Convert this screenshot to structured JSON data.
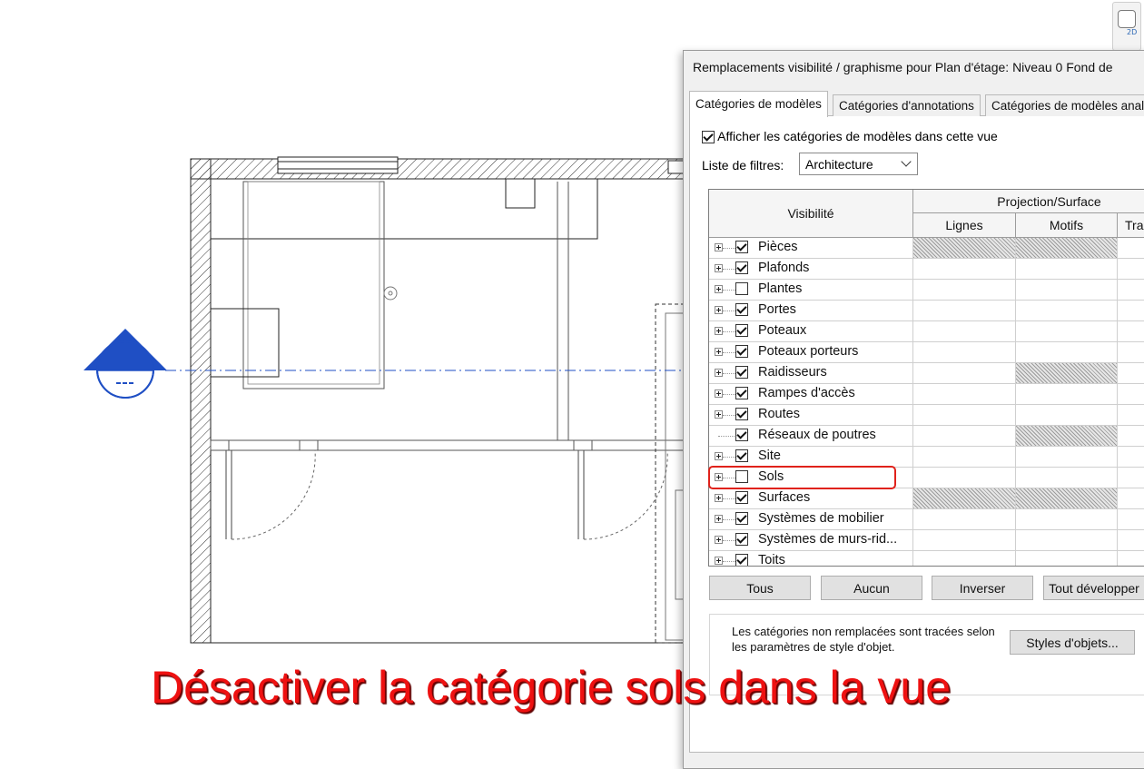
{
  "dialog": {
    "title": "Remplacements visibilité / graphisme pour Plan d'étage: Niveau 0 Fond de",
    "tabs": [
      {
        "label": "Catégories de modèles",
        "active": true
      },
      {
        "label": "Catégories d'annotations",
        "active": false
      },
      {
        "label": "Catégories de modèles anal",
        "active": false
      }
    ],
    "show_categories_label": "Afficher les catégories de modèles dans cette vue",
    "show_categories_checked": true,
    "filter_list_label": "Liste de filtres:",
    "filter_value": "Architecture"
  },
  "grid": {
    "header_visibility": "Visibilité",
    "header_group": "Projection/Surface",
    "columns": [
      "Lignes",
      "Motifs",
      "Tra"
    ],
    "rows": [
      {
        "name": "Pièces",
        "checked": true,
        "expandable": true,
        "hatch": [
          true,
          true
        ]
      },
      {
        "name": "Plafonds",
        "checked": true,
        "expandable": true,
        "hatch": [
          false,
          false
        ]
      },
      {
        "name": "Plantes",
        "checked": false,
        "expandable": true,
        "hatch": [
          false,
          false
        ]
      },
      {
        "name": "Portes",
        "checked": true,
        "expandable": true,
        "hatch": [
          false,
          false
        ]
      },
      {
        "name": "Poteaux",
        "checked": true,
        "expandable": true,
        "hatch": [
          false,
          false
        ]
      },
      {
        "name": "Poteaux porteurs",
        "checked": true,
        "expandable": true,
        "hatch": [
          false,
          false
        ]
      },
      {
        "name": "Raidisseurs",
        "checked": true,
        "expandable": true,
        "hatch": [
          false,
          true
        ]
      },
      {
        "name": "Rampes d'accès",
        "checked": true,
        "expandable": true,
        "hatch": [
          false,
          false
        ]
      },
      {
        "name": "Routes",
        "checked": true,
        "expandable": true,
        "hatch": [
          false,
          false
        ]
      },
      {
        "name": "Réseaux de poutres",
        "checked": true,
        "expandable": false,
        "hatch": [
          false,
          true
        ]
      },
      {
        "name": "Site",
        "checked": true,
        "expandable": true,
        "hatch": [
          false,
          false
        ]
      },
      {
        "name": "Sols",
        "checked": false,
        "expandable": true,
        "hatch": [
          false,
          false
        ]
      },
      {
        "name": "Surfaces",
        "checked": true,
        "expandable": true,
        "hatch": [
          true,
          true
        ]
      },
      {
        "name": "Systèmes de mobilier",
        "checked": true,
        "expandable": true,
        "hatch": [
          false,
          false
        ]
      },
      {
        "name": "Systèmes de murs-rid...",
        "checked": true,
        "expandable": true,
        "hatch": [
          false,
          false
        ]
      },
      {
        "name": "Toits",
        "checked": true,
        "expandable": true,
        "hatch": [
          false,
          false
        ]
      }
    ]
  },
  "buttons": {
    "all": "Tous",
    "none": "Aucun",
    "invert": "Inverser",
    "expand_all": "Tout développer",
    "object_styles": "Styles d'objets..."
  },
  "note": "Les catégories non remplacées sont tracées selon les paramètres de style d'objet.",
  "caption": "Désactiver la catégorie sols dans la vue",
  "view_cube_label": "2D",
  "colors": {
    "caption": "#ee1111",
    "highlight": "#e0221b",
    "section_marker": "#1f4fc4"
  }
}
